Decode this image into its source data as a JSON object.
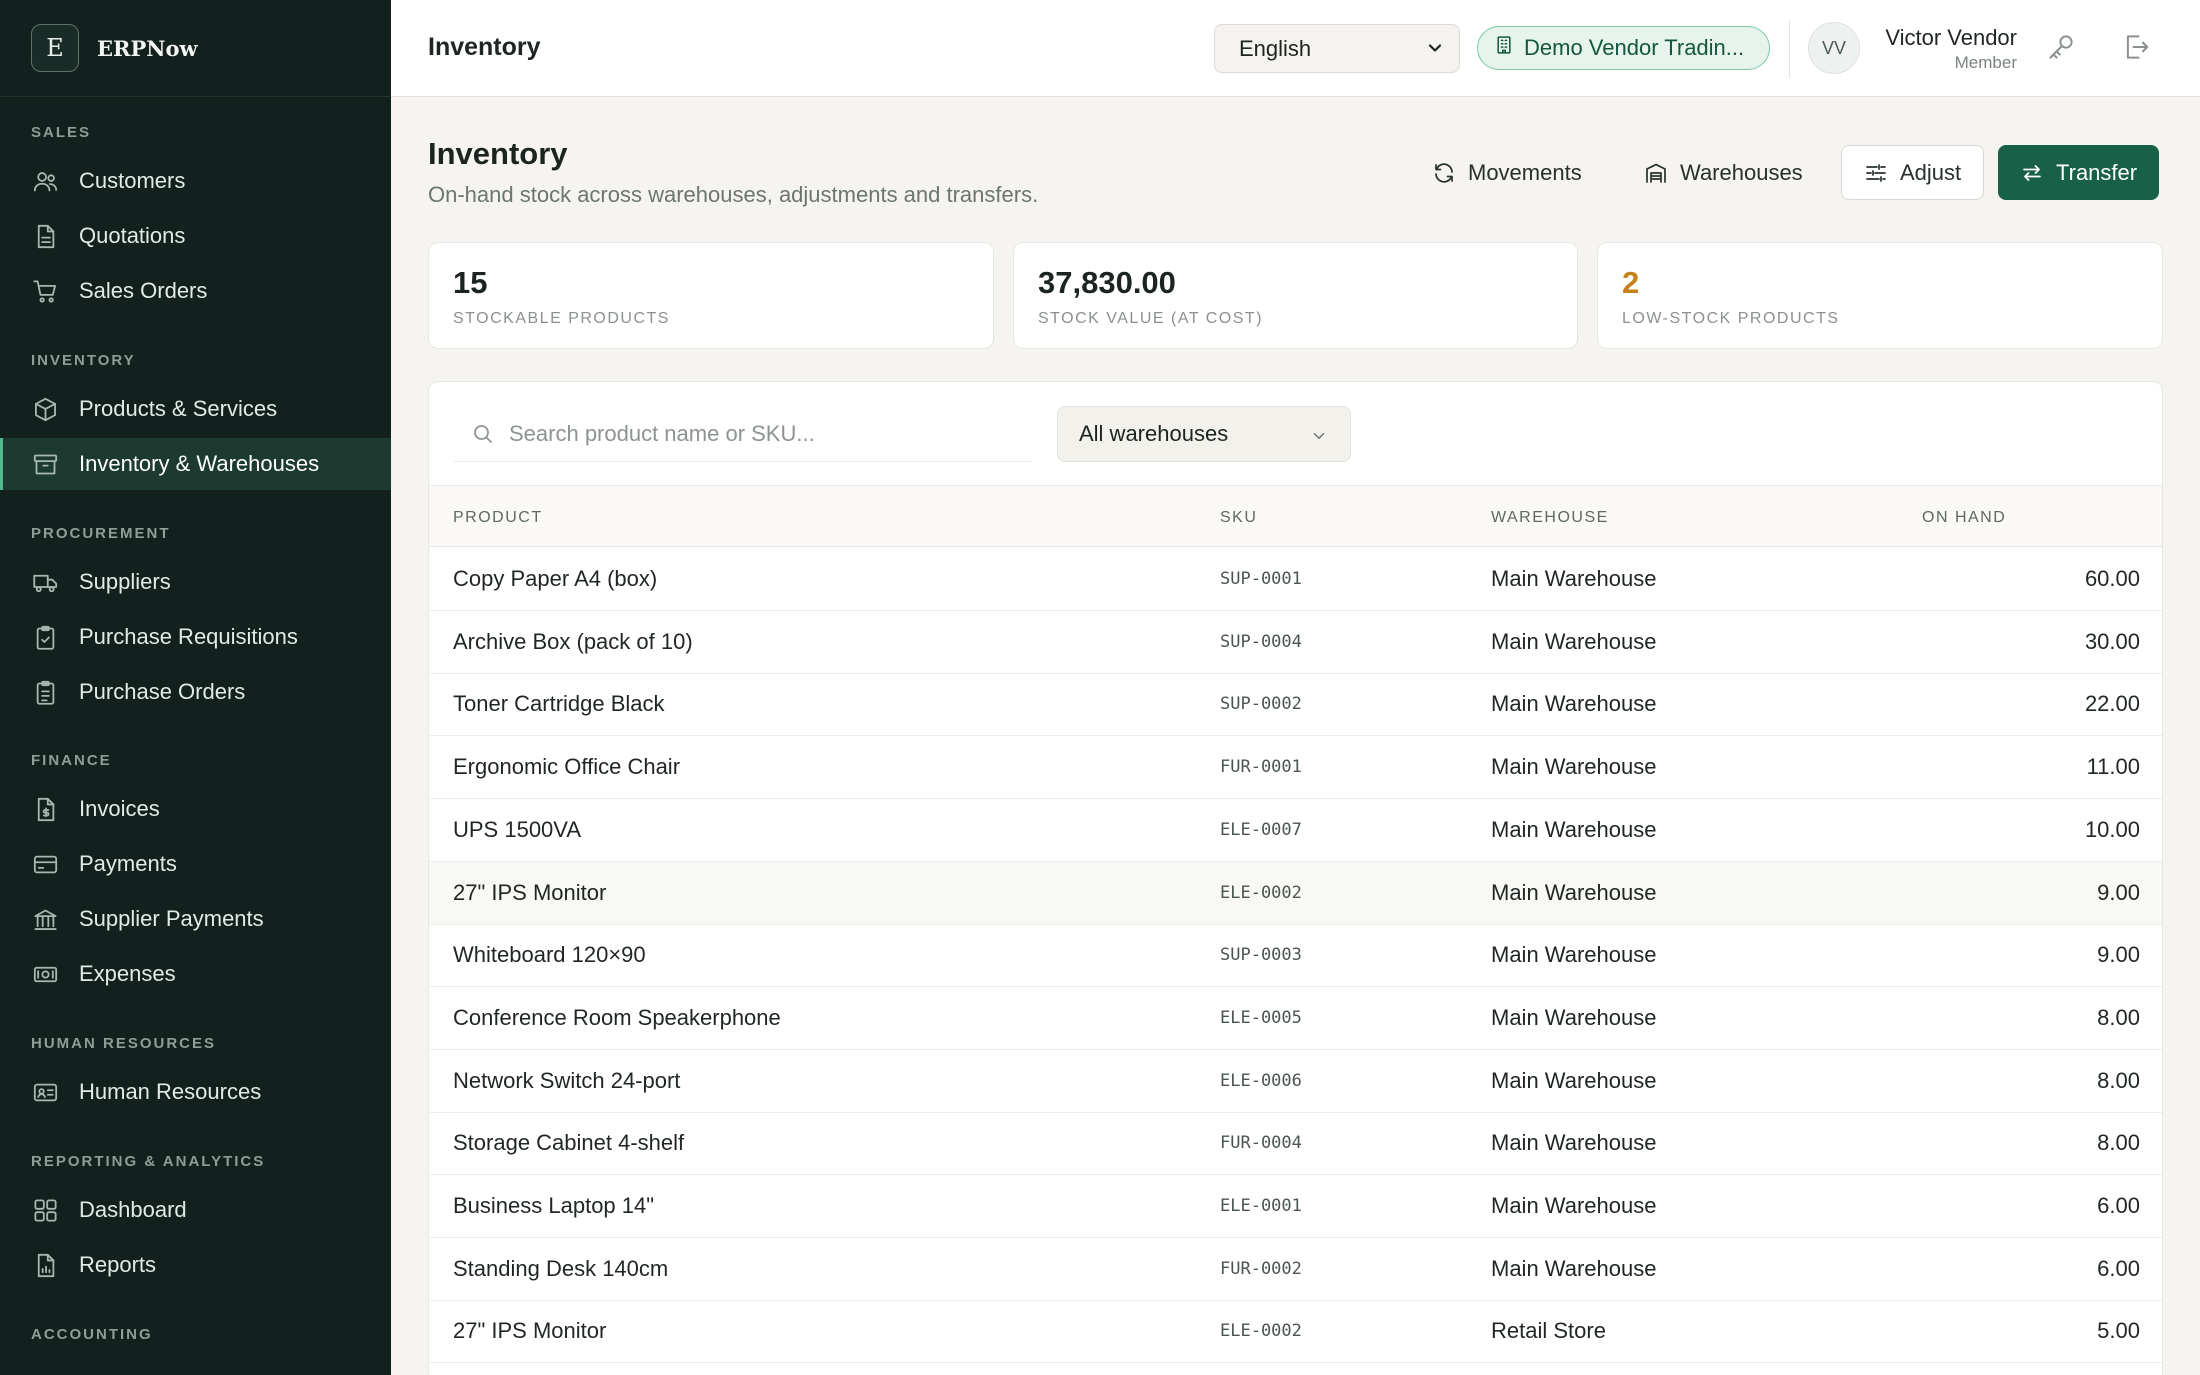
{
  "app": {
    "brand_initial": "E",
    "brand_name": "ERPNow"
  },
  "sidebar": {
    "sections": [
      {
        "label": "SALES"
      },
      {
        "label": "INVENTORY"
      },
      {
        "label": "PROCUREMENT"
      },
      {
        "label": "FINANCE"
      },
      {
        "label": "HUMAN RESOURCES"
      },
      {
        "label": "REPORTING & ANALYTICS"
      },
      {
        "label": "ACCOUNTING"
      }
    ],
    "items": [
      {
        "label": "Customers",
        "icon": "users-icon"
      },
      {
        "label": "Quotations",
        "icon": "document-icon"
      },
      {
        "label": "Sales Orders",
        "icon": "cart-icon"
      },
      {
        "label": "Products & Services",
        "icon": "box-icon"
      },
      {
        "label": "Inventory & Warehouses",
        "icon": "archive-icon",
        "active": true
      },
      {
        "label": "Suppliers",
        "icon": "truck-icon"
      },
      {
        "label": "Purchase Requisitions",
        "icon": "clipboard-icon"
      },
      {
        "label": "Purchase Orders",
        "icon": "clipboard-list-icon"
      },
      {
        "label": "Invoices",
        "icon": "invoice-icon"
      },
      {
        "label": "Payments",
        "icon": "credit-card-icon"
      },
      {
        "label": "Supplier Payments",
        "icon": "bank-icon"
      },
      {
        "label": "Expenses",
        "icon": "banknote-icon"
      },
      {
        "label": "Human Resources",
        "icon": "id-card-icon"
      },
      {
        "label": "Dashboard",
        "icon": "grid-icon"
      },
      {
        "label": "Reports",
        "icon": "report-icon"
      }
    ]
  },
  "topbar": {
    "title": "Inventory",
    "language": "English",
    "company": "Demo Vendor Tradin...",
    "user_initials": "VV",
    "user_name": "Victor Vendor",
    "user_role": "Member"
  },
  "page": {
    "title": "Inventory",
    "subtitle": "On-hand stock across warehouses, adjustments and transfers.",
    "actions": {
      "movements": "Movements",
      "warehouses": "Warehouses",
      "adjust": "Adjust",
      "transfer": "Transfer"
    }
  },
  "stats": [
    {
      "value": "15",
      "label": "STOCKABLE PRODUCTS"
    },
    {
      "value": "37,830.00",
      "label": "STOCK VALUE (AT COST)"
    },
    {
      "value": "2",
      "label": "LOW-STOCK PRODUCTS"
    }
  ],
  "filters": {
    "search_placeholder": "Search product name or SKU...",
    "warehouse_selected": "All warehouses"
  },
  "table": {
    "headers": {
      "product": "PRODUCT",
      "sku": "SKU",
      "warehouse": "WAREHOUSE",
      "on_hand": "ON HAND"
    },
    "rows": [
      {
        "product": "Copy Paper A4 (box)",
        "sku": "SUP-0001",
        "warehouse": "Main Warehouse",
        "on_hand": "60.00"
      },
      {
        "product": "Archive Box (pack of 10)",
        "sku": "SUP-0004",
        "warehouse": "Main Warehouse",
        "on_hand": "30.00"
      },
      {
        "product": "Toner Cartridge Black",
        "sku": "SUP-0002",
        "warehouse": "Main Warehouse",
        "on_hand": "22.00"
      },
      {
        "product": "Ergonomic Office Chair",
        "sku": "FUR-0001",
        "warehouse": "Main Warehouse",
        "on_hand": "11.00"
      },
      {
        "product": "UPS 1500VA",
        "sku": "ELE-0007",
        "warehouse": "Main Warehouse",
        "on_hand": "10.00"
      },
      {
        "product": "27\" IPS Monitor",
        "sku": "ELE-0002",
        "warehouse": "Main Warehouse",
        "on_hand": "9.00"
      },
      {
        "product": "Whiteboard 120×90",
        "sku": "SUP-0003",
        "warehouse": "Main Warehouse",
        "on_hand": "9.00"
      },
      {
        "product": "Conference Room Speakerphone",
        "sku": "ELE-0005",
        "warehouse": "Main Warehouse",
        "on_hand": "8.00"
      },
      {
        "product": "Network Switch 24-port",
        "sku": "ELE-0006",
        "warehouse": "Main Warehouse",
        "on_hand": "8.00"
      },
      {
        "product": "Storage Cabinet 4-shelf",
        "sku": "FUR-0004",
        "warehouse": "Main Warehouse",
        "on_hand": "8.00"
      },
      {
        "product": "Business Laptop 14\"",
        "sku": "ELE-0001",
        "warehouse": "Main Warehouse",
        "on_hand": "6.00"
      },
      {
        "product": "Standing Desk 140cm",
        "sku": "FUR-0002",
        "warehouse": "Main Warehouse",
        "on_hand": "6.00"
      },
      {
        "product": "27\" IPS Monitor",
        "sku": "ELE-0002",
        "warehouse": "Retail Store",
        "on_hand": "5.00"
      }
    ]
  },
  "colors": {
    "sidebar_bg": "#12211d",
    "accent": "#186148",
    "warning": "#c5821c",
    "page_bg": "#f5f4f0"
  }
}
